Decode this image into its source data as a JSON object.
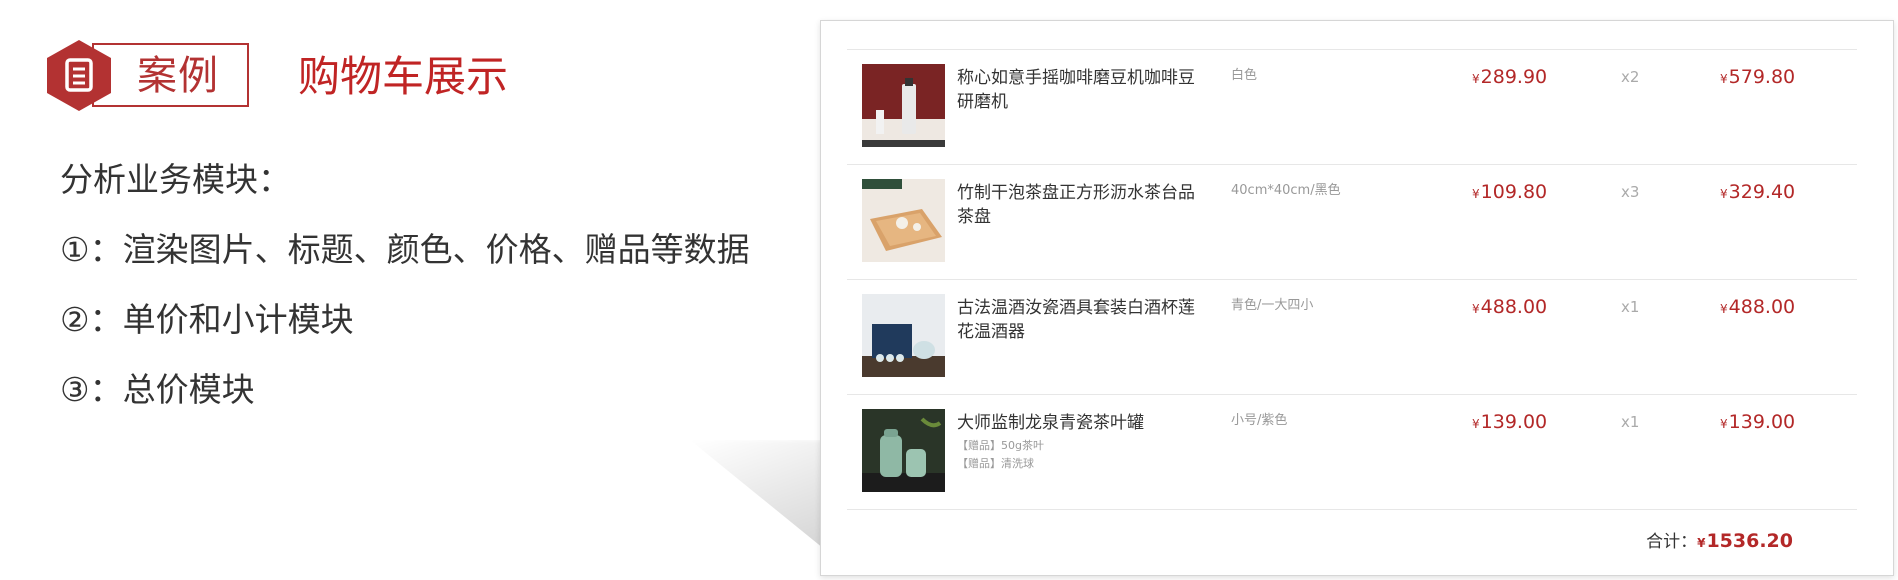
{
  "header": {
    "case_label": "案例",
    "title": "购物车展示",
    "accent_color": "#b33232",
    "icon": "document-icon"
  },
  "analysis": {
    "heading": "分析业务模块：",
    "items": [
      "①：渲染图片、标题、颜色、价格、赠品等数据",
      "②：单价和小计模块",
      "③：总价模块"
    ]
  },
  "cart": {
    "items": [
      {
        "name": "称心如意手摇咖啡磨豆机咖啡豆研磨机",
        "spec": "白色",
        "currency": "¥",
        "price": "289.90",
        "qty": "x2",
        "subtotal": "579.80",
        "gifts": []
      },
      {
        "name": "竹制干泡茶盘正方形沥水茶台品茶盘",
        "spec": "40cm*40cm/黑色",
        "currency": "¥",
        "price": "109.80",
        "qty": "x3",
        "subtotal": "329.40",
        "gifts": []
      },
      {
        "name": "古法温酒汝瓷酒具套装白酒杯莲花温酒器",
        "spec": "青色/一大四小",
        "currency": "¥",
        "price": "488.00",
        "qty": "x1",
        "subtotal": "488.00",
        "gifts": []
      },
      {
        "name": "大师监制龙泉青瓷茶叶罐",
        "spec": "小号/紫色",
        "currency": "¥",
        "price": "139.00",
        "qty": "x1",
        "subtotal": "139.00",
        "gifts": [
          "【赠品】50g茶叶",
          "【赠品】清洗球"
        ]
      }
    ],
    "total_label": "合计：",
    "currency": "¥",
    "total": "1536.20",
    "price_color": "#b32828"
  }
}
